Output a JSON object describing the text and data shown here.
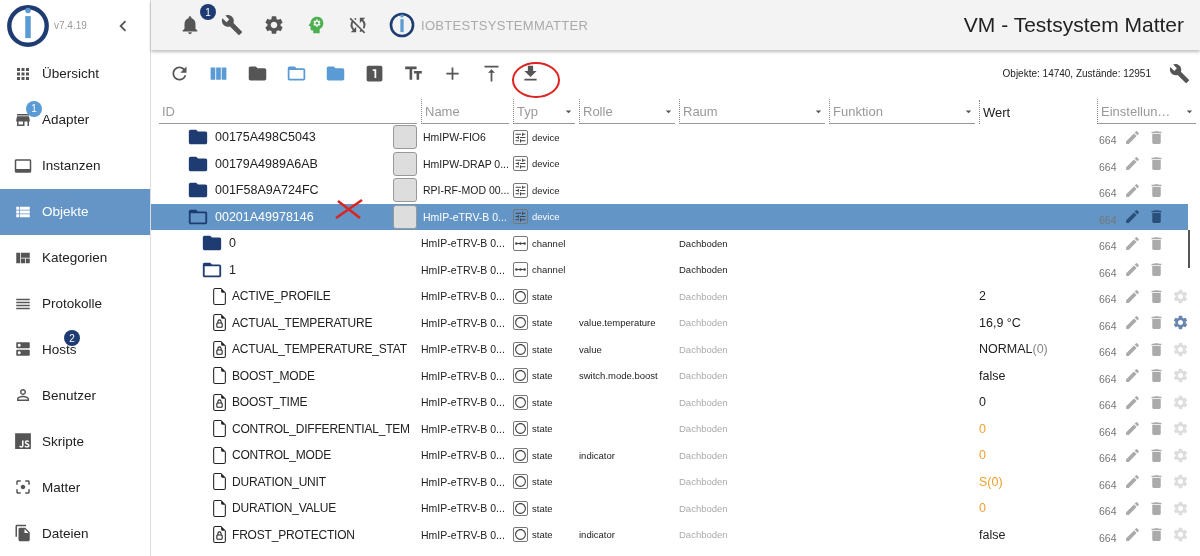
{
  "sidebar": {
    "version": "v7.4.19",
    "items": [
      {
        "label": "Übersicht",
        "selected": false
      },
      {
        "label": "Adapter",
        "badge": "1",
        "selected": false
      },
      {
        "label": "Instanzen",
        "selected": false
      },
      {
        "label": "Objekte",
        "selected": true
      },
      {
        "label": "Kategorien",
        "selected": false
      },
      {
        "label": "Protokolle",
        "selected": false
      },
      {
        "label": "Hosts",
        "badge": "2",
        "selected": false
      },
      {
        "label": "Benutzer",
        "selected": false
      },
      {
        "label": "Skripte",
        "selected": false
      },
      {
        "label": "Matter",
        "selected": false
      },
      {
        "label": "Dateien",
        "selected": false
      }
    ]
  },
  "header": {
    "notification_badge": "1",
    "system_name": "IOBTESTSYSTEMMATTER",
    "title": "VM - Testsystem Matter"
  },
  "toolbar": {
    "stats": "Objekte: 14740, Zustände: 12951"
  },
  "table": {
    "columns": [
      {
        "label": "ID",
        "kind": "input"
      },
      {
        "label": "Name",
        "kind": "input"
      },
      {
        "label": "Typ",
        "kind": "select"
      },
      {
        "label": "Rolle",
        "kind": "select"
      },
      {
        "label": "Raum",
        "kind": "select"
      },
      {
        "label": "Funktion",
        "kind": "select"
      },
      {
        "label": "Wert",
        "kind": "label"
      },
      {
        "label": "Einstellun…",
        "kind": "select"
      }
    ],
    "rows": [
      {
        "id": "00175A498C5043",
        "kind": "device",
        "name": "HmIPW-FIO6",
        "type": "device",
        "acl": "664",
        "expanded": false,
        "selected": false
      },
      {
        "id": "00179A4989A6AB",
        "kind": "device",
        "name": "HmIPW-DRAP 0...",
        "type": "device",
        "acl": "664",
        "expanded": false,
        "selected": false
      },
      {
        "id": "001F58A9A724FC",
        "kind": "device",
        "name": "RPI-RF-MOD 00...",
        "type": "device",
        "acl": "664",
        "expanded": false,
        "selected": false
      },
      {
        "id": "00201A49978146",
        "kind": "device",
        "name": "HmIP-eTRV-B 0...",
        "type": "device",
        "acl": "664",
        "expanded": true,
        "selected": true,
        "children": [
          {
            "id": "0",
            "kind": "channel",
            "name": "HmIP-eTRV-B 0...",
            "type": "channel",
            "room": "Dachboden",
            "acl": "664",
            "expanded": false,
            "selected": false
          },
          {
            "id": "1",
            "kind": "channel",
            "name": "HmIP-eTRV-B 0...",
            "type": "channel",
            "room": "Dachboden",
            "acl": "664",
            "expanded": true,
            "selected": false,
            "children": [
              {
                "id": "ACTIVE_PROFILE",
                "kind": "state",
                "name": "HmIP-eTRV-B 0...",
                "type": "state",
                "room": "Dachboden",
                "value": "2",
                "ack": true,
                "acl": "664",
                "locked": false,
                "custom": false,
                "selected": false
              },
              {
                "id": "ACTUAL_TEMPERATURE",
                "kind": "state",
                "name": "HmIP-eTRV-B 0...",
                "type": "state",
                "role": "value.temperature",
                "room": "Dachboden",
                "value": "16,9 °C",
                "ack": true,
                "acl": "664",
                "locked": true,
                "custom": true,
                "selected": false
              },
              {
                "id": "ACTUAL_TEMPERATURE_STAT",
                "kind": "state",
                "name": "HmIP-eTRV-B 0...",
                "type": "state",
                "role": "value",
                "room": "Dachboden",
                "value": "NORMAL",
                "value_suffix": "(0)",
                "ack": true,
                "acl": "664",
                "locked": true,
                "custom": false,
                "selected": false
              },
              {
                "id": "BOOST_MODE",
                "kind": "state",
                "name": "HmIP-eTRV-B 0...",
                "type": "state",
                "role": "switch.mode.boost",
                "room": "Dachboden",
                "value": "false",
                "ack": true,
                "acl": "664",
                "locked": false,
                "custom": false,
                "selected": false
              },
              {
                "id": "BOOST_TIME",
                "kind": "state",
                "name": "HmIP-eTRV-B 0...",
                "type": "state",
                "room": "Dachboden",
                "value": "0",
                "ack": true,
                "acl": "664",
                "locked": true,
                "custom": false,
                "selected": false
              },
              {
                "id": "CONTROL_DIFFERENTIAL_TEM",
                "kind": "state",
                "name": "HmIP-eTRV-B 0...",
                "type": "state",
                "room": "Dachboden",
                "value": "0",
                "ack": false,
                "acl": "664",
                "locked": false,
                "custom": false,
                "selected": false
              },
              {
                "id": "CONTROL_MODE",
                "kind": "state",
                "name": "HmIP-eTRV-B 0...",
                "type": "state",
                "role": "indicator",
                "room": "Dachboden",
                "value": "0",
                "ack": false,
                "acl": "664",
                "locked": false,
                "custom": false,
                "selected": false
              },
              {
                "id": "DURATION_UNIT",
                "kind": "state",
                "name": "HmIP-eTRV-B 0...",
                "type": "state",
                "room": "Dachboden",
                "value": "S(0)",
                "ack": false,
                "acl": "664",
                "locked": false,
                "custom": false,
                "selected": false
              },
              {
                "id": "DURATION_VALUE",
                "kind": "state",
                "name": "HmIP-eTRV-B 0...",
                "type": "state",
                "room": "Dachboden",
                "value": "0",
                "ack": false,
                "acl": "664",
                "locked": false,
                "custom": false,
                "selected": false
              },
              {
                "id": "FROST_PROTECTION",
                "kind": "state",
                "name": "HmIP-eTRV-B 0...",
                "type": "state",
                "role": "indicator",
                "room": "Dachboden",
                "value": "false",
                "ack": true,
                "acl": "664",
                "locked": true,
                "custom": false,
                "selected": false
              }
            ]
          }
        ]
      }
    ]
  }
}
